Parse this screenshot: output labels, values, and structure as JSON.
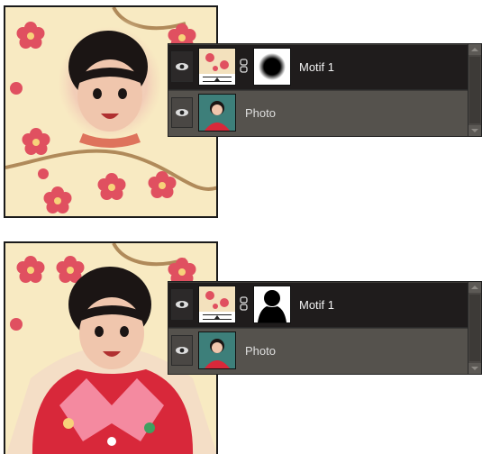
{
  "figures": [
    {
      "layers_panel": {
        "layers": [
          {
            "name": "Motif 1",
            "selected": true,
            "mask_shape": "round-blob"
          },
          {
            "name": "Photo",
            "selected": false
          }
        ]
      }
    },
    {
      "layers_panel": {
        "layers": [
          {
            "name": "Motif 1",
            "selected": true,
            "mask_shape": "silhouette"
          },
          {
            "name": "Photo",
            "selected": false
          }
        ]
      }
    }
  ],
  "colors": {
    "panel_bg": "#3c3a37",
    "selected_row": "#1f1c1c",
    "normal_row": "#55524d",
    "label_text": "#f2f2f2",
    "wallpaper": "#f8eac2",
    "blossom": "#e05060"
  },
  "icons": {
    "visibility": "eye-icon",
    "link": "chain-link-icon",
    "scroll_up": "chevron-up-icon",
    "scroll_down": "chevron-down-icon"
  }
}
